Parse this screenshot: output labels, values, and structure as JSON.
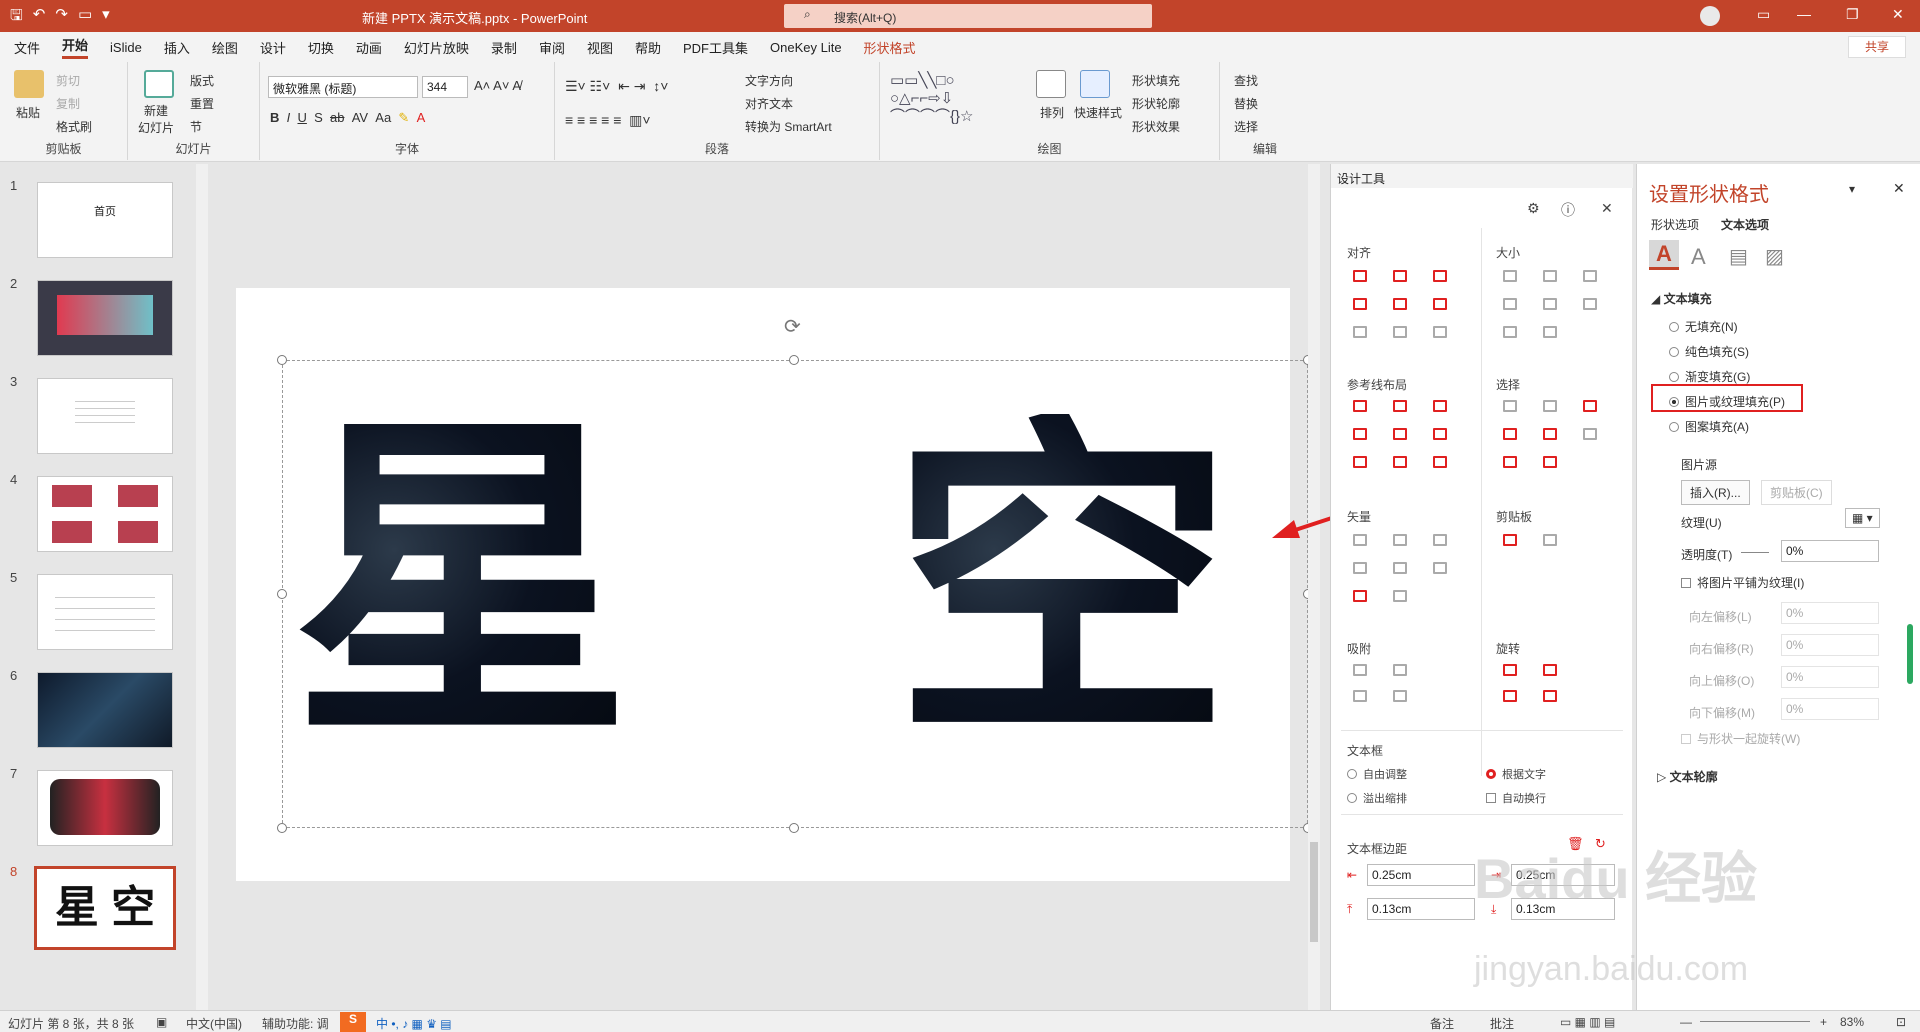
{
  "titlebar": {
    "doc_title": "新建 PPTX 演示文稿.pptx - PowerPoint",
    "search": "搜索(Alt+Q)"
  },
  "menu": {
    "tabs": [
      "文件",
      "开始",
      "iSlide",
      "插入",
      "绘图",
      "设计",
      "切换",
      "动画",
      "幻灯片放映",
      "录制",
      "审阅",
      "视图",
      "帮助",
      "PDF工具集",
      "OneKey Lite",
      "形状格式"
    ],
    "active": "开始",
    "share": "共享"
  },
  "ribbon": {
    "clipboard": {
      "paste": "粘贴",
      "cut": "剪切",
      "copy": "复制",
      "painter": "格式刷",
      "label": "剪贴板"
    },
    "slides": {
      "new": "新建\n幻灯片",
      "layout": "版式",
      "reset": "重置",
      "section": "节",
      "label": "幻灯片"
    },
    "font": {
      "name": "微软雅黑 (标题)",
      "size": "344",
      "label": "字体"
    },
    "paragraph": {
      "text_dir": "文字方向",
      "align_text": "对齐文本",
      "smartart": "转换为 SmartArt",
      "label": "段落"
    },
    "drawing": {
      "arrange": "排列",
      "quick_styles": "快速样式",
      "fill": "形状填充",
      "outline": "形状轮廓",
      "effects": "形状效果",
      "label": "绘图"
    },
    "editing": {
      "find": "查找",
      "replace": "替换",
      "select": "选择",
      "label": "编辑"
    }
  },
  "thumbnails": [
    {
      "num": "1",
      "text": "首页"
    },
    {
      "num": "2",
      "text": ""
    },
    {
      "num": "3",
      "text": ""
    },
    {
      "num": "4",
      "text": ""
    },
    {
      "num": "5",
      "text": ""
    },
    {
      "num": "6",
      "text": ""
    },
    {
      "num": "7",
      "text": ""
    },
    {
      "num": "8",
      "text": "星 空"
    }
  ],
  "slide": {
    "char1": "星",
    "char2": "空"
  },
  "design_tools": {
    "title": "设计工具",
    "align": "对齐",
    "size": "大小",
    "guides": "参考线布局",
    "select": "选择",
    "vector": "矢量",
    "clipboard": "剪贴板",
    "snap": "吸附",
    "rotate": "旋转",
    "textbox": "文本框",
    "auto_adjust": "自由调整",
    "fit_text": "根据文字",
    "overflow": "溢出缩排",
    "wrap": "自动换行",
    "margins": "文本框边距",
    "m_left": "0.25cm",
    "m_right": "0.25cm",
    "m_top": "0.13cm",
    "m_bottom": "0.13cm"
  },
  "format_pane": {
    "title": "设置形状格式",
    "tab_shape": "形状选项",
    "tab_text": "文本选项",
    "text_fill": "文本填充",
    "opts": [
      "无填充(N)",
      "纯色填充(S)",
      "渐变填充(G)",
      "图片或纹理填充(P)",
      "图案填充(A)"
    ],
    "selected": "图片或纹理填充(P)",
    "pic_source": "图片源",
    "insert": "插入(R)...",
    "clipboard": "剪贴板(C)",
    "texture": "纹理(U)",
    "transparency": "透明度(T)",
    "trans_val": "0%",
    "tile": "将图片平铺为纹理(I)",
    "off_left": "向左偏移(L)",
    "off_right": "向右偏移(R)",
    "off_up": "向上偏移(O)",
    "off_down": "向下偏移(M)",
    "off_val": "0%",
    "rotate_with": "与形状一起旋转(W)",
    "text_outline": "文本轮廓"
  },
  "statusbar": {
    "slide_info": "幻灯片 第 8 张，共 8 张",
    "lang": "中文(中国)",
    "access": "辅助功能: 调",
    "notes": "备注",
    "comments": "批注",
    "zoom": "83%"
  },
  "watermark": {
    "logo": "Baidu 经验",
    "url": "jingyan.baidu.com"
  },
  "colors": {
    "accent": "#c2442a",
    "highlight": "#e02020"
  }
}
